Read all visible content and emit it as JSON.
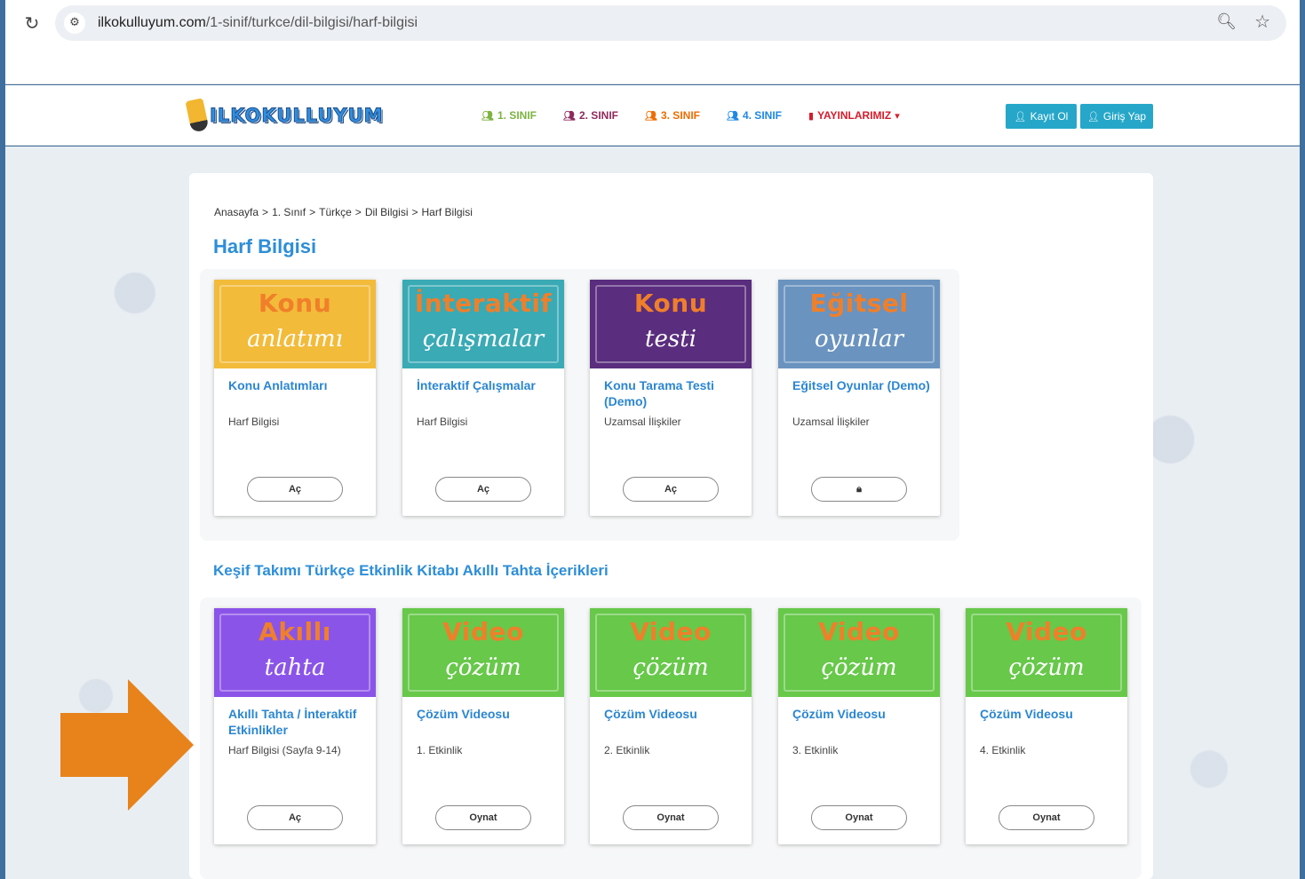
{
  "browser": {
    "url_host": "ilkokulluyum.com",
    "url_path": "/1-sinif/turkce/dil-bilgisi/harf-bilgisi"
  },
  "header": {
    "logo_text": "ILKOKULLUYUM",
    "nav": [
      {
        "label": "1. SINIF",
        "color": "#7cb342"
      },
      {
        "label": "2. SINIF",
        "color": "#8e2a5c"
      },
      {
        "label": "3. SINIF",
        "color": "#ef6c00"
      },
      {
        "label": "4. SINIF",
        "color": "#1e88e5"
      },
      {
        "label": "YAYINLARIMIZ",
        "color": "#d81b2a"
      }
    ],
    "register_label": "Kayıt Ol",
    "login_label": "Giriş Yap"
  },
  "breadcrumb": [
    "Anasayfa",
    "1. Sınıf",
    "Türkçe",
    "Dil Bilgisi",
    "Harf Bilgisi"
  ],
  "breadcrumb_sep": ">",
  "page_title": "Harf Bilgisi",
  "cards_row1": [
    {
      "thumb_top": "Konu",
      "thumb_bottom": "anlatımı",
      "color": "#f2bb3a",
      "title": "Konu Anlatımları",
      "subtitle": "Harf Bilgisi",
      "button": "Aç"
    },
    {
      "thumb_top": "İnteraktif",
      "thumb_bottom": "çalışmalar",
      "color": "#3aaab5",
      "title": "İnteraktif Çalışmalar",
      "subtitle": "Harf Bilgisi",
      "button": "Aç"
    },
    {
      "thumb_top": "Konu",
      "thumb_bottom": "testi",
      "color": "#5a2d7e",
      "title": "Konu Tarama Testi (Demo)",
      "subtitle": "Uzamsal İlişkiler",
      "button": "Aç"
    },
    {
      "thumb_top": "Eğitsel",
      "thumb_bottom": "oyunlar",
      "color": "#6a93bf",
      "title": "Eğitsel Oyunlar (Demo)",
      "subtitle": "Uzamsal İlişkiler",
      "button": "",
      "locked": true
    }
  ],
  "section_title": "Keşif Takımı Türkçe Etkinlik Kitabı Akıllı Tahta İçerikleri",
  "cards_row2": [
    {
      "thumb_top": "Akıllı",
      "thumb_bottom": "tahta",
      "color": "#8b54e8",
      "title": "Akıllı Tahta / İnteraktif Etkinlikler",
      "subtitle": "Harf Bilgisi (Sayfa 9-14)",
      "button": "Aç"
    },
    {
      "thumb_top": "Video",
      "thumb_bottom": "çözüm",
      "color": "#67c84a",
      "title": "Çözüm Videosu",
      "subtitle": "1. Etkinlik",
      "button": "Oynat"
    },
    {
      "thumb_top": "Video",
      "thumb_bottom": "çözüm",
      "color": "#67c84a",
      "title": "Çözüm Videosu",
      "subtitle": "2. Etkinlik",
      "button": "Oynat"
    },
    {
      "thumb_top": "Video",
      "thumb_bottom": "çözüm",
      "color": "#67c84a",
      "title": "Çözüm Videosu",
      "subtitle": "3. Etkinlik",
      "button": "Oynat"
    },
    {
      "thumb_top": "Video",
      "thumb_bottom": "çözüm",
      "color": "#67c84a",
      "title": "Çözüm Videosu",
      "subtitle": "4. Etkinlik",
      "button": "Oynat"
    }
  ],
  "arrow_color": "#e8821a"
}
